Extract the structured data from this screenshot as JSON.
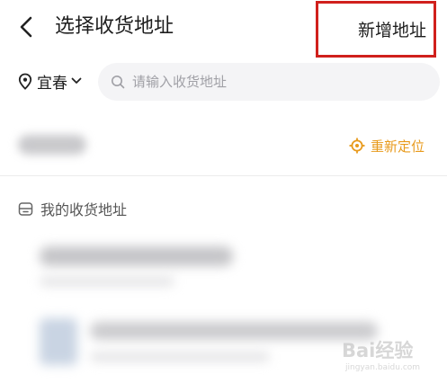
{
  "header": {
    "title": "选择收货地址",
    "add_address_label": "新增地址",
    "highlight_color": "#d0201c"
  },
  "location_bar": {
    "city": "宜春",
    "search_placeholder": "请输入收货地址"
  },
  "current_location": {
    "relocate_label": "重新定位",
    "accent_color": "#e89a1c"
  },
  "saved_addresses": {
    "section_title": "我的收货地址"
  },
  "watermark": {
    "logo_text": "Bai经验",
    "sub_text": "jingyan.baidu.com"
  },
  "icons": {
    "back": "chevron-left-icon",
    "location_pin": "location-pin-icon",
    "dropdown": "chevron-down-icon",
    "search": "search-icon",
    "relocate": "crosshair-icon",
    "address_book": "address-book-icon"
  }
}
